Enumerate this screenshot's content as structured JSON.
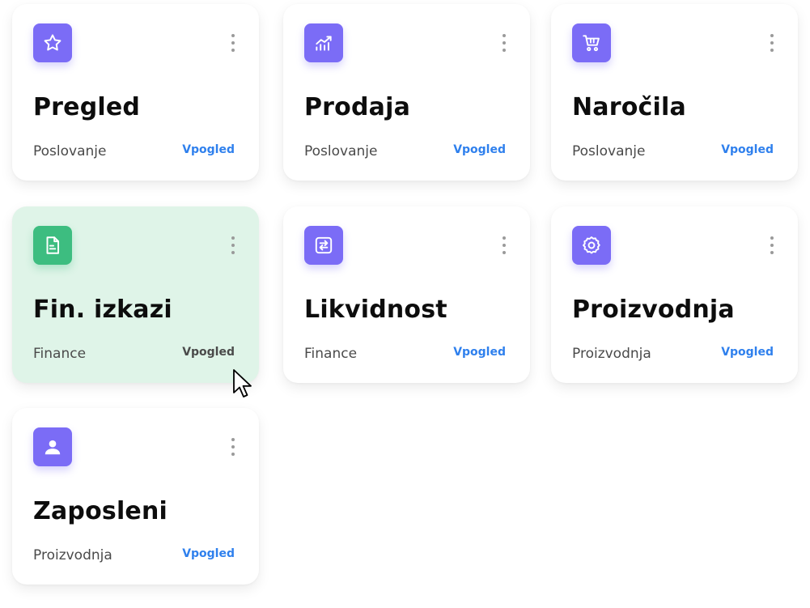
{
  "cards": [
    {
      "title": "Pregled",
      "category": "Poslovanje",
      "link_label": "Vpogled",
      "icon": "star-icon",
      "active": false
    },
    {
      "title": "Prodaja",
      "category": "Poslovanje",
      "link_label": "Vpogled",
      "icon": "chart-up-icon",
      "active": false
    },
    {
      "title": "Naročila",
      "category": "Poslovanje",
      "link_label": "Vpogled",
      "icon": "cart-icon",
      "active": false
    },
    {
      "title": "Fin. izkazi",
      "category": "Finance",
      "link_label": "Vpogled",
      "icon": "document-icon",
      "active": true
    },
    {
      "title": "Likvidnost",
      "category": "Finance",
      "link_label": "Vpogled",
      "icon": "exchange-icon",
      "active": false
    },
    {
      "title": "Proizvodnja",
      "category": "Proizvodnja",
      "link_label": "Vpogled",
      "icon": "gear-icon",
      "active": false
    },
    {
      "title": "Zaposleni",
      "category": "Proizvodnja",
      "link_label": "Vpogled",
      "icon": "user-icon",
      "active": false
    }
  ],
  "colors": {
    "icon_purple": "#7b6cf6",
    "icon_green": "#3dbd80",
    "active_card_bg": "#dff4e8",
    "link_blue": "#2f80ed"
  }
}
